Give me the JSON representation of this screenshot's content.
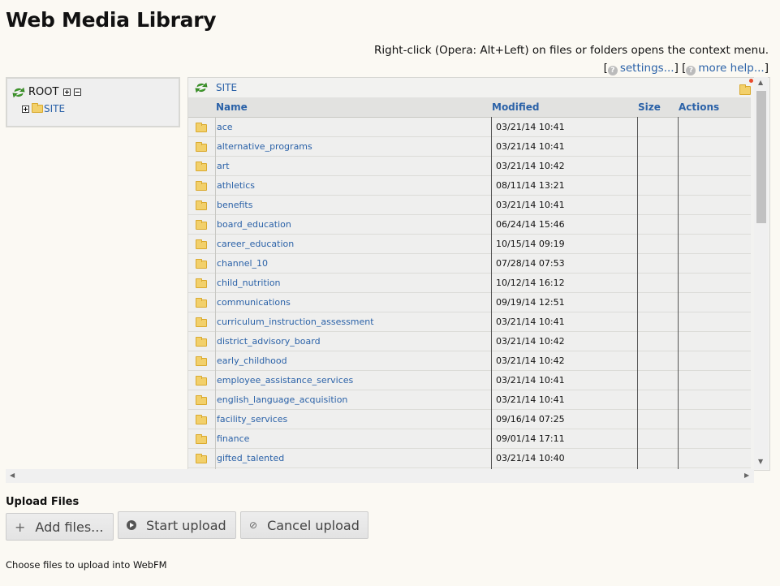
{
  "title": "Web Media Library",
  "hint": "Right-click (Opera: Alt+Left) on files or folders opens the context menu.",
  "help": {
    "settings": "settings...",
    "more_help": "more help..."
  },
  "tree": {
    "root": "ROOT",
    "child": "SITE"
  },
  "browser": {
    "path": "SITE",
    "columns": {
      "name": "Name",
      "modified": "Modified",
      "size": "Size",
      "actions": "Actions"
    },
    "rows": [
      {
        "name": "ace",
        "modified": "03/21/14 10:41"
      },
      {
        "name": "alternative_programs",
        "modified": "03/21/14 10:41"
      },
      {
        "name": "art",
        "modified": "03/21/14 10:42"
      },
      {
        "name": "athletics",
        "modified": "08/11/14 13:21"
      },
      {
        "name": "benefits",
        "modified": "03/21/14 10:41"
      },
      {
        "name": "board_education",
        "modified": "06/24/14 15:46"
      },
      {
        "name": "career_education",
        "modified": "10/15/14 09:19"
      },
      {
        "name": "channel_10",
        "modified": "07/28/14 07:53"
      },
      {
        "name": "child_nutrition",
        "modified": "10/12/14 16:12"
      },
      {
        "name": "communications",
        "modified": "09/19/14 12:51"
      },
      {
        "name": "curriculum_instruction_assessment",
        "modified": "03/21/14 10:41"
      },
      {
        "name": "district_advisory_board",
        "modified": "03/21/14 10:42"
      },
      {
        "name": "early_childhood",
        "modified": "03/21/14 10:42"
      },
      {
        "name": "employee_assistance_services",
        "modified": "03/21/14 10:41"
      },
      {
        "name": "english_language_acquisition",
        "modified": "03/21/14 10:41"
      },
      {
        "name": "facility_services",
        "modified": "09/16/14 07:25"
      },
      {
        "name": "finance",
        "modified": "09/01/14 17:11"
      },
      {
        "name": "gifted_talented",
        "modified": "03/21/14 10:40"
      }
    ]
  },
  "upload": {
    "title": "Upload Files",
    "add": "Add files...",
    "start": "Start upload",
    "cancel": "Cancel upload",
    "status": "Choose files to upload into WebFM"
  }
}
